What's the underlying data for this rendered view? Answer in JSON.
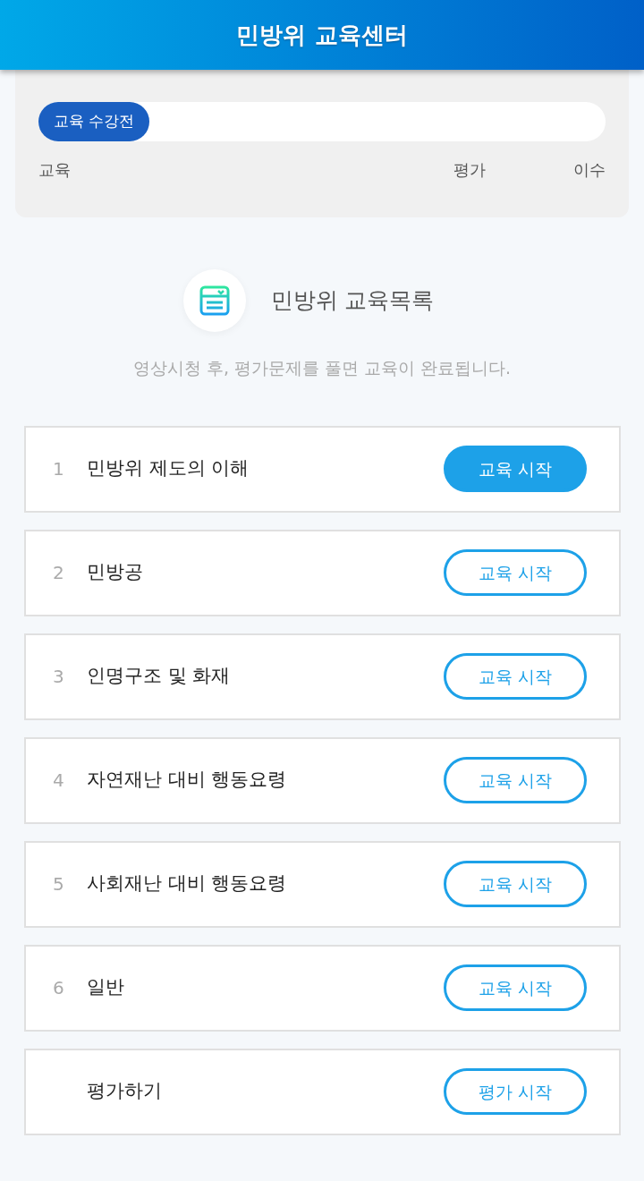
{
  "header": {
    "title": "민방위 교육센터"
  },
  "status": {
    "badge": "교육 수강전",
    "steps": [
      "교육",
      "평가",
      "이수"
    ]
  },
  "section": {
    "title": "민방위 교육목록",
    "subtitle": "영상시청 후, 평가문제를 풀면 교육이 완료됩니다."
  },
  "courses": [
    {
      "number": "1",
      "title": "민방위 제도의 이해",
      "button": "교육 시작",
      "filled": true
    },
    {
      "number": "2",
      "title": "민방공",
      "button": "교육 시작",
      "filled": false
    },
    {
      "number": "3",
      "title": "인명구조 및 화재",
      "button": "교육 시작",
      "filled": false
    },
    {
      "number": "4",
      "title": "자연재난 대비 행동요령",
      "button": "교육 시작",
      "filled": false
    },
    {
      "number": "5",
      "title": "사회재난 대비 행동요령",
      "button": "교육 시작",
      "filled": false
    },
    {
      "number": "6",
      "title": "일반",
      "button": "교육 시작",
      "filled": false
    },
    {
      "title": "평가하기",
      "button": "평가 시작",
      "filled": false
    }
  ]
}
